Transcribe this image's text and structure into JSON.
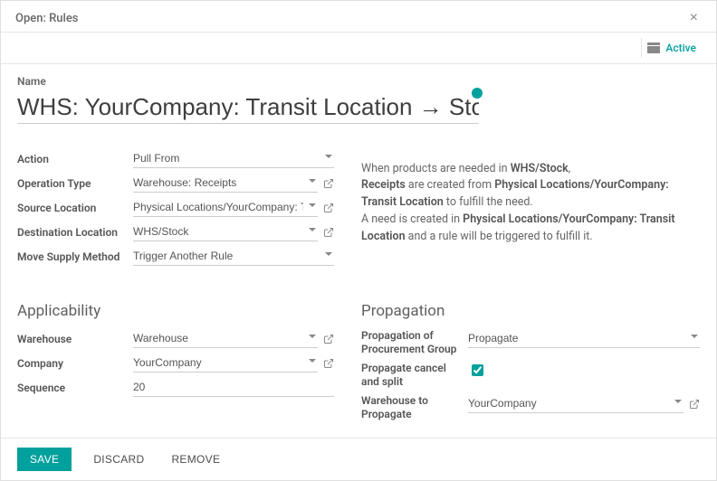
{
  "modal": {
    "title": "Open: Rules",
    "status_label": "Active"
  },
  "name_label": "Name",
  "name_value": "WHS: YourCompany: Transit Location → Stock",
  "labels": {
    "action": "Action",
    "operation_type": "Operation Type",
    "source_location": "Source Location",
    "destination_location": "Destination Location",
    "move_supply_method": "Move Supply Method",
    "applicability": "Applicability",
    "warehouse": "Warehouse",
    "company": "Company",
    "sequence": "Sequence",
    "propagation": "Propagation",
    "propagation_group": "Propagation of Procurement Group",
    "propagate_cancel": "Propagate cancel and split",
    "warehouse_to_propagate": "Warehouse to Propagate"
  },
  "values": {
    "action": "Pull From",
    "operation_type": "Warehouse: Receipts",
    "source_location": "Physical Locations/YourCompany: Transit",
    "destination_location": "WHS/Stock",
    "move_supply_method": "Trigger Another Rule",
    "warehouse": "Warehouse",
    "company": "YourCompany",
    "sequence": "20",
    "propagation_group": "Propagate",
    "propagate_cancel": true,
    "warehouse_to_propagate": "YourCompany"
  },
  "description": {
    "line1a": "When products are needed in ",
    "line1b": "WHS/Stock",
    "line1c": ",",
    "line2a": "Receipts",
    "line2b": " are created from ",
    "line2c": "Physical Locations/YourCompany: Transit Location",
    "line2d": " to fulfill the need.",
    "line3a": "A need is created in ",
    "line3b": "Physical Locations/YourCompany: Transit Location",
    "line3c": " and a rule will be triggered to fulfill it."
  },
  "buttons": {
    "save": "SAVE",
    "discard": "DISCARD",
    "remove": "REMOVE"
  }
}
